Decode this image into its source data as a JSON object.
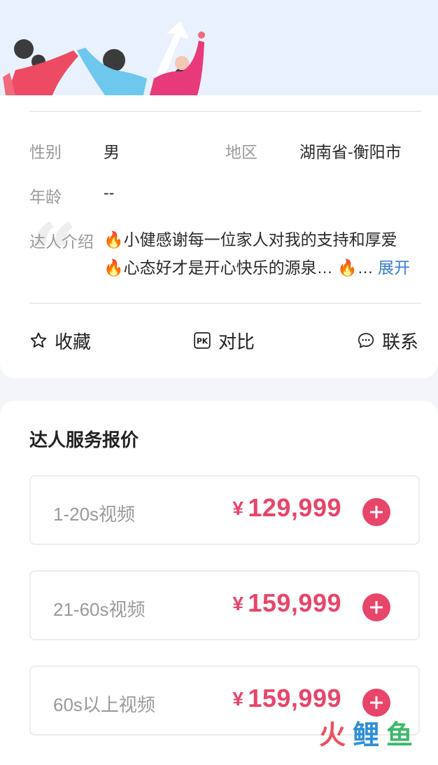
{
  "profile": {
    "gender_label": "性别",
    "gender_value": "男",
    "region_label": "地区",
    "region_value": "湖南省-衡阳市",
    "age_label": "年龄",
    "age_value": "--",
    "intro_label": "达人介绍",
    "intro_line1": "🔥小健感谢每一位家人对我的支持和厚爱",
    "intro_line2": "🔥心态好才是开心快乐的源泉… 🔥…",
    "intro_more": "展开"
  },
  "actions": {
    "favorite": "收藏",
    "compare": "对比",
    "contact": "联系"
  },
  "pricing": {
    "title": "达人服务报价",
    "currency": "¥",
    "items": [
      {
        "name": "1-20s视频",
        "price": "129,999"
      },
      {
        "name": "21-60s视频",
        "price": "159,999"
      },
      {
        "name": "60s以上视频",
        "price": "159,999"
      }
    ]
  },
  "colors": {
    "accent": "#e8456b",
    "link": "#3a7bd5",
    "hero_bg": "#e9f1fc"
  },
  "icons": [
    "star-icon",
    "pk-icon",
    "chat-icon",
    "plus-icon"
  ],
  "watermark": "火鲤鱼"
}
